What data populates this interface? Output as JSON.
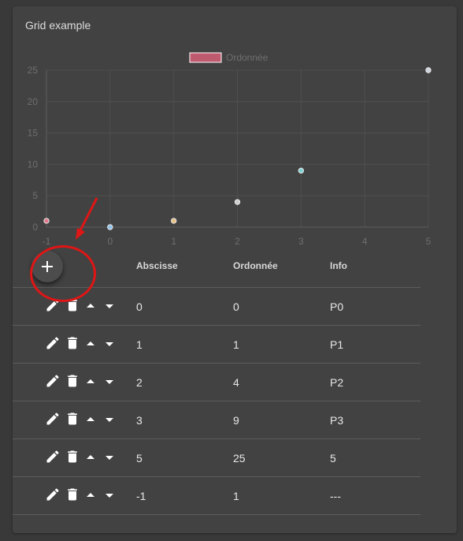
{
  "card": {
    "title": "Grid example"
  },
  "chart_data": {
    "type": "scatter",
    "legend": [
      "Ordonnée"
    ],
    "legend_position": "top",
    "series": [
      {
        "name": "Ordonnée",
        "x": [
          0,
          1,
          2,
          3,
          5,
          -1
        ],
        "y": [
          0,
          1,
          4,
          9,
          25,
          1
        ]
      }
    ],
    "point_colors": [
      "#8ec3ea",
      "#e8c083",
      "#cfcfcf",
      "#7fd3d6",
      "#cfd3dc",
      "#e07a8d"
    ],
    "xlim": [
      -1,
      5
    ],
    "ylim": [
      0,
      25
    ],
    "x_ticks": [
      "-1",
      "0",
      "1",
      "2",
      "3",
      "4",
      "5"
    ],
    "y_ticks": [
      "0",
      "5",
      "10",
      "15",
      "20",
      "25"
    ],
    "grid": true,
    "legend_color": "#c05a6e"
  },
  "table": {
    "headers": {
      "abscisse": "Abscisse",
      "ordonnee": "Ordonnée",
      "info": "Info"
    },
    "rows": [
      {
        "x": "0",
        "y": "0",
        "info": "P0"
      },
      {
        "x": "1",
        "y": "1",
        "info": "P1"
      },
      {
        "x": "2",
        "y": "4",
        "info": "P2"
      },
      {
        "x": "3",
        "y": "9",
        "info": "P3"
      },
      {
        "x": "5",
        "y": "25",
        "info": "5"
      },
      {
        "x": "-1",
        "y": "1",
        "info": "---"
      }
    ]
  },
  "icons": {
    "add": "plus-icon",
    "edit": "pencil-icon",
    "delete": "trash-icon",
    "up": "caret-up-icon",
    "down": "caret-down-icon"
  },
  "annotation_color": "#e01515"
}
